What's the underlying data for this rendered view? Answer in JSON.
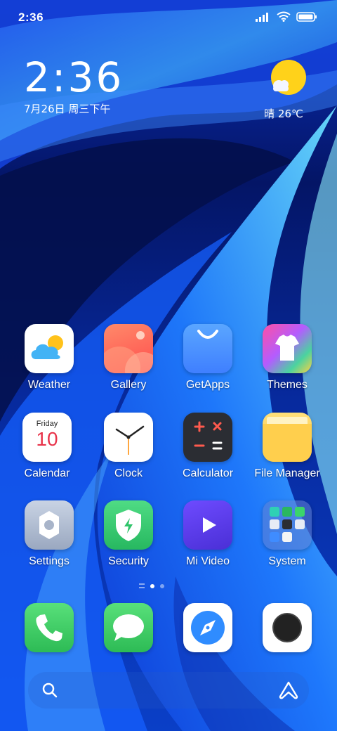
{
  "status_bar": {
    "time": "2:36"
  },
  "clock_widget": {
    "time": "2:36",
    "date": "7月26日 周三下午"
  },
  "weather_widget": {
    "temperature": "晴 26℃"
  },
  "apps": [
    {
      "label": "Weather",
      "icon": "weather-icon"
    },
    {
      "label": "Gallery",
      "icon": "gallery-icon"
    },
    {
      "label": "GetApps",
      "icon": "getapps-icon"
    },
    {
      "label": "Themes",
      "icon": "themes-icon"
    },
    {
      "label": "Calendar",
      "icon": "calendar-icon",
      "day": "Friday",
      "date": "10"
    },
    {
      "label": "Clock",
      "icon": "clock-icon"
    },
    {
      "label": "Calculator",
      "icon": "calculator-icon"
    },
    {
      "label": "File Manager",
      "icon": "file-manager-icon"
    },
    {
      "label": "Settings",
      "icon": "settings-icon"
    },
    {
      "label": "Security",
      "icon": "security-icon"
    },
    {
      "label": "Mi Video",
      "icon": "mi-video-icon"
    },
    {
      "label": "System",
      "icon": "system-folder-icon"
    }
  ],
  "dock": [
    {
      "icon": "phone-icon"
    },
    {
      "icon": "messages-icon"
    },
    {
      "icon": "browser-icon"
    },
    {
      "icon": "camera-icon"
    }
  ],
  "page_indicator": {
    "pages": 2,
    "active": 1
  },
  "colors": {
    "wallpaper_dark": "#041a6e",
    "wallpaper_light": "#3fb6ff",
    "sun": "#ffd21a"
  }
}
